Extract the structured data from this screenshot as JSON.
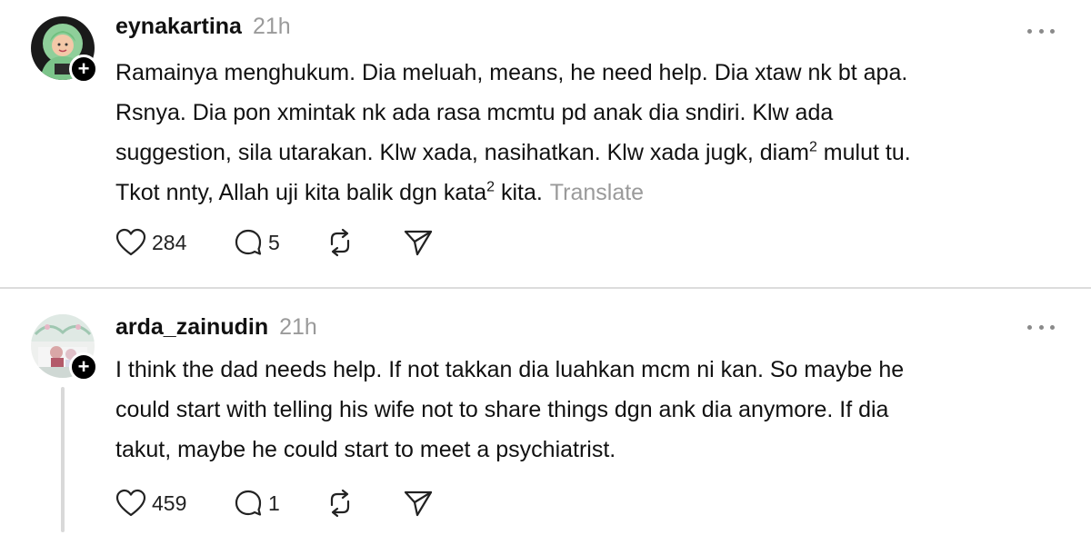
{
  "posts": [
    {
      "username": "eynakartina",
      "timestamp": "21h",
      "avatar_icon": "profile-photo-hijab",
      "body_lines": [
        [
          "Ramainya menghukum. Dia meluah, means, he need help. Dia xtaw nk bt apa."
        ],
        [
          "Rsnya. Dia pon xmintak nk ada rasa mcmtu pd anak dia sndiri. Klw ada"
        ],
        [
          "suggestion, sila utarakan. Klw xada, nasihatkan. Klw xada jugk, diam",
          "2",
          " mulut tu."
        ],
        [
          "Tkot nnty, Allah uji kita balik dgn kata",
          "2",
          " kita."
        ]
      ],
      "translate_label": "Translate",
      "likes": "284",
      "replies": "5"
    },
    {
      "username": "arda_zainudin",
      "timestamp": "21h",
      "avatar_icon": "profile-photo-room",
      "body_lines": [
        [
          "I think the dad needs help. If not takkan dia luahkan mcm ni kan. So maybe he"
        ],
        [
          "could start with telling his wife not to share things dgn ank dia anymore. If dia"
        ],
        [
          "takut, maybe he could start to meet a psychiatrist."
        ]
      ],
      "likes": "459",
      "replies": "1"
    }
  ],
  "icons": {
    "like": "heart-icon",
    "reply": "comment-bubble-icon",
    "repost": "repost-icon",
    "share": "send-icon",
    "more": "more-horizontal-icon",
    "follow": "plus-icon"
  },
  "colors": {
    "text": "#111111",
    "muted": "#9a9a9a",
    "divider": "#dcdcdc"
  }
}
